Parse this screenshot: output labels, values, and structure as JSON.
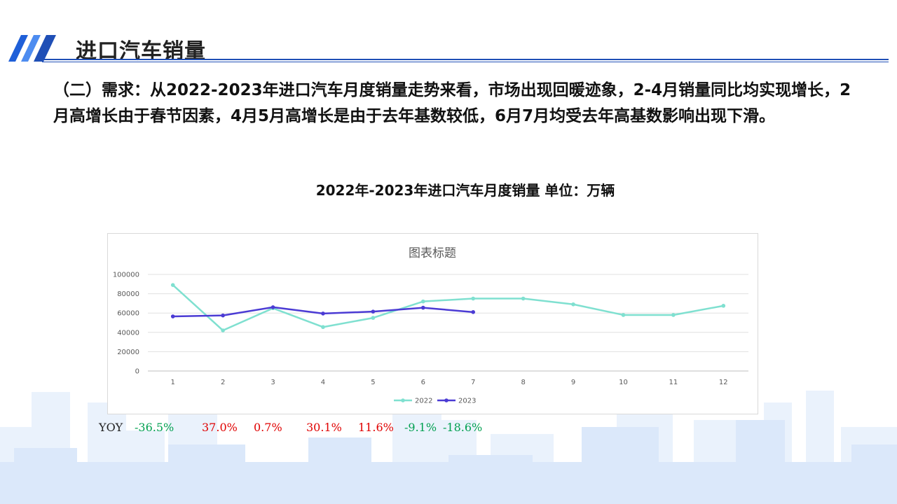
{
  "header": {
    "title": "进口汽车销量"
  },
  "paragraph": "（二）需求：从2022-2023年进口汽车月度销量走势来看，市场出现回暖迹象，2-4月销量同比均实现增长，2月高增长由于春节因素，4月5月高增长是由于去年基数较低，6月7月均受去年高基数影响出现下滑。",
  "subtitle": "2022年-2023年进口汽车月度销量  单位：万辆",
  "colors": {
    "brand": "#1f4fb6",
    "positive": "#e00000",
    "negative": "#00a050",
    "series_2022": "#7fe0d0",
    "series_2023": "#4b3bd4"
  },
  "chart_data": {
    "type": "line",
    "title": "图表标题",
    "x": [
      "1",
      "2",
      "3",
      "4",
      "5",
      "6",
      "7",
      "8",
      "9",
      "10",
      "11",
      "12"
    ],
    "y_ticks": [
      "0",
      "20000",
      "40000",
      "60000",
      "80000",
      "100000"
    ],
    "ylim": [
      0,
      100000
    ],
    "grid": true,
    "legend_position": "bottom",
    "series": [
      {
        "name": "2022",
        "color": "#7fe0d0",
        "values": [
          89000,
          42000,
          65000,
          45500,
          55000,
          72000,
          75000,
          75000,
          69000,
          58000,
          58000,
          67500
        ]
      },
      {
        "name": "2023",
        "color": "#4b3bd4",
        "values": [
          56500,
          57500,
          66000,
          59500,
          61500,
          65500,
          61000
        ]
      }
    ]
  },
  "yoy": {
    "label": "YOY",
    "values": [
      {
        "text": "-36.5%",
        "color": "#00a050"
      },
      {
        "text": "37.0%",
        "color": "#e00000"
      },
      {
        "text": "0.7%",
        "color": "#e00000"
      },
      {
        "text": "30.1%",
        "color": "#e00000"
      },
      {
        "text": "11.6%",
        "color": "#e00000"
      },
      {
        "text": "-9.1%",
        "color": "#00a050"
      },
      {
        "text": "-18.6%",
        "color": "#00a050"
      }
    ]
  }
}
